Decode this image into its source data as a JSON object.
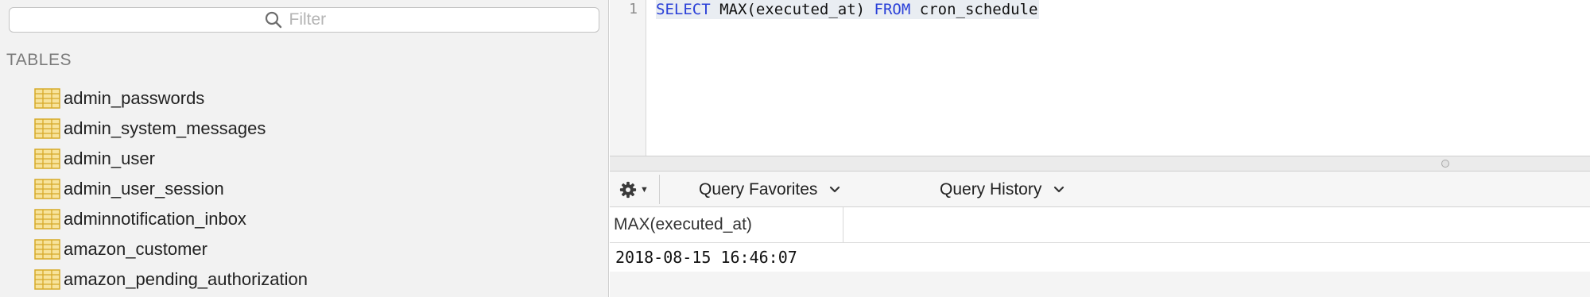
{
  "sidebar": {
    "filter_placeholder": "Filter",
    "section_title": "TABLES",
    "tables": [
      "admin_passwords",
      "admin_system_messages",
      "admin_user",
      "admin_user_session",
      "adminnotification_inbox",
      "amazon_customer",
      "amazon_pending_authorization"
    ],
    "table_icon": "table-grid-icon"
  },
  "editor": {
    "line_number": "1",
    "tokens": {
      "select_kw": "SELECT",
      "expr": " MAX(executed_at) ",
      "from_kw": "FROM",
      "table": " cron_schedule"
    },
    "keyword_color": "#2a40d8"
  },
  "toolbar": {
    "gear_icon": "gear-icon",
    "favorites_label": "Query Favorites",
    "history_label": "Query History"
  },
  "results": {
    "columns": [
      "MAX(executed_at)"
    ],
    "rows": [
      [
        "2018-08-15 16:46:07"
      ]
    ]
  },
  "colors": {
    "table_icon_fill": "#f7e39b",
    "table_icon_stroke": "#d6a928"
  }
}
